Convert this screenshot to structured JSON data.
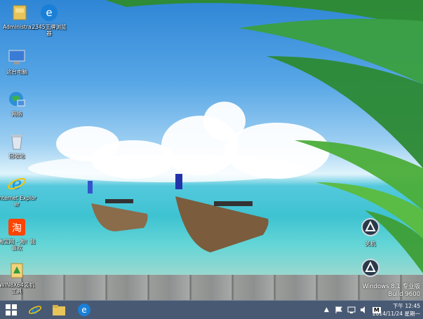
{
  "desktop_icons": [
    {
      "name": "administrator-folder-icon",
      "label": "Administra..."
    },
    {
      "name": "browser-2345-icon",
      "label": "2345王牌浏览器"
    },
    {
      "name": "this-pc-icon",
      "label": "这台电脑"
    },
    {
      "name": "network-icon",
      "label": "网络"
    },
    {
      "name": "recycle-bin-icon",
      "label": "回收站"
    },
    {
      "name": "internet-explorer-icon",
      "label": "Internet Explorer"
    },
    {
      "name": "taobao-icon",
      "label": "淘宝网 - 淘！我喜欢"
    },
    {
      "name": "win8x64-tool-icon",
      "label": "WIN8X64装机工具"
    }
  ],
  "gadgets": [
    {
      "name": "shutdown-gadget",
      "label": "关机"
    }
  ],
  "watermark": {
    "line1": "Windows 8.1 专业版",
    "line2": "Build 9600"
  },
  "taskbar": {
    "clock_time": "下午 12:45",
    "clock_date": "2014/11/24 星期一",
    "ime_label": "M"
  },
  "colors": {
    "taskbar": "#283c5a",
    "ie_blue": "#1a7fd6",
    "taobao_orange": "#ff4400"
  }
}
